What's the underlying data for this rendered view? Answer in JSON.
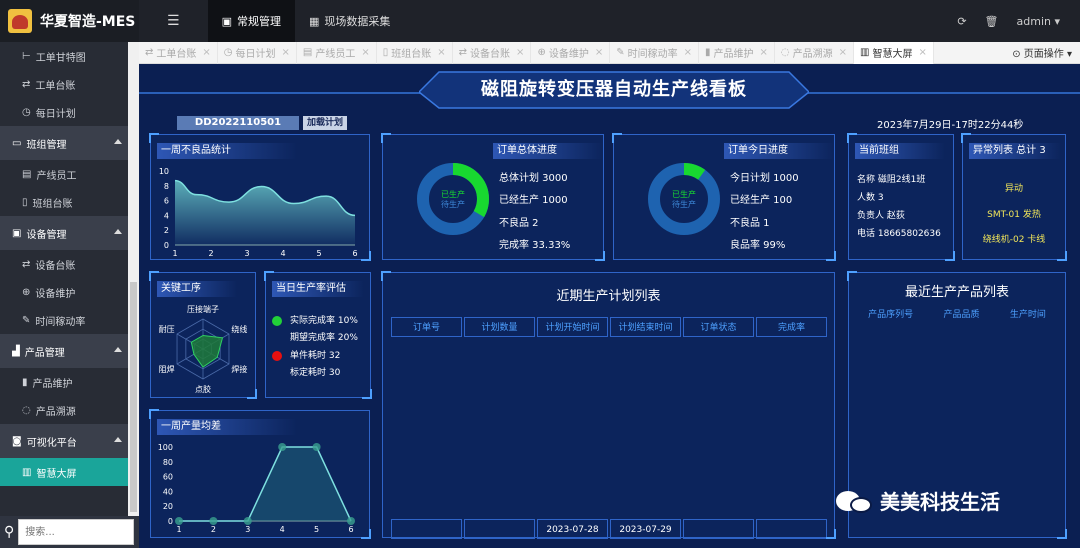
{
  "topbar": {
    "brand": "华夏智造-MES",
    "menu_icon": "menu-icon",
    "tabs": [
      "常规管理",
      "现场数据采集"
    ],
    "user": "admin"
  },
  "sidebar": {
    "items_top": [
      "工单甘特图",
      "工单台账",
      "每日计划"
    ],
    "group1": {
      "label": "班组管理",
      "items": [
        "产线员工",
        "班组台账"
      ]
    },
    "group2": {
      "label": "设备管理",
      "items": [
        "设备台账",
        "设备维护",
        "时间稼动率"
      ]
    },
    "group3": {
      "label": "产品管理",
      "items": [
        "产品维护",
        "产品溯源"
      ]
    },
    "group4": {
      "label": "可视化平台",
      "items": [
        "智慧大屏"
      ]
    },
    "search_placeholder": "搜索..."
  },
  "tabs": [
    {
      "label": "工单台账"
    },
    {
      "label": "每日计划"
    },
    {
      "label": "产线员工"
    },
    {
      "label": "班组台账"
    },
    {
      "label": "设备台账"
    },
    {
      "label": "设备维护"
    },
    {
      "label": "时间稼动率"
    },
    {
      "label": "产品维护"
    },
    {
      "label": "产品溯源"
    },
    {
      "label": "智慧大屏"
    }
  ],
  "tab_ops": "页面操作",
  "dashboard": {
    "title": "磁阻旋转变压器自动生产线看板",
    "order_no": "DD2022110501",
    "load_plan": "加载计划",
    "datetime": "2023年7月29日-17时22分44秒",
    "weekly_defects": {
      "title": "一周不良品统计"
    },
    "total_progress": {
      "title": "订单总体进度",
      "donut_labels": [
        "已生产",
        "待生产"
      ],
      "stats": [
        "总体计划 3000",
        "已经生产 1000",
        "不良品 2",
        "完成率 33.33%"
      ]
    },
    "today_progress": {
      "title": "订单今日进度",
      "donut_labels": [
        "已生产",
        "待生产"
      ],
      "stats": [
        "今日计划 1000",
        "已经生产 100",
        "不良品 1",
        "良品率 99%"
      ]
    },
    "team": {
      "title": "当前班组",
      "stats": [
        "名称 磁阻2线1班",
        "人数 3",
        "负责人 赵荻",
        "电话 18665802636"
      ]
    },
    "abnormal": {
      "title": "异常列表 总计 3",
      "items": [
        "异动",
        "SMT-01 发热",
        "绕线机-02 卡线"
      ]
    },
    "key_process": {
      "title": "关键工序"
    },
    "rate_eval": {
      "title": "当日生产率评估",
      "items": [
        "实际完成率 10%",
        "期望完成率 20%",
        "单件耗时 32",
        "标定耗时 30"
      ],
      "colors": [
        "#22d038",
        "#22d038",
        "#e81010",
        "#e81010"
      ]
    },
    "plan_list": {
      "title": "近期生产计划列表",
      "headers": [
        "订单号",
        "计划数量",
        "计划开始时间",
        "计划结束时间",
        "订单状态",
        "完成率"
      ],
      "row_partial": [
        "",
        "",
        "2023-07-28",
        "2023-07-29",
        "",
        ""
      ]
    },
    "recent_products": {
      "title": "最近生产产品列表",
      "headers": [
        "产品序列号",
        "产品品质",
        "生产时间"
      ]
    },
    "weekly_variance": {
      "title": "一周产量均差"
    },
    "watermark": "美美科技生活"
  },
  "chart_data": [
    {
      "type": "area",
      "title": "一周不良品统计",
      "x": [
        1,
        2,
        3,
        4,
        5,
        6
      ],
      "values": [
        8.7,
        6.8,
        5.8,
        7.9,
        5.6,
        6.6,
        4.0
      ],
      "x_positions": [
        1,
        1.6,
        2.5,
        3.4,
        4.3,
        5.2,
        6
      ],
      "ylim": [
        0,
        10
      ],
      "yticks": [
        0,
        2,
        4,
        6,
        8,
        10
      ],
      "grid": false
    },
    {
      "type": "radar",
      "title": "关键工序",
      "axes": [
        "压接端子",
        "绕线",
        "焊接",
        "点胶",
        "阻焊",
        "耐压"
      ],
      "values": [
        0.45,
        0.75,
        0.55,
        0.6,
        0.35,
        0.45
      ]
    },
    {
      "type": "line",
      "title": "一周产量均差",
      "x": [
        1,
        2,
        3,
        4,
        5,
        6
      ],
      "values": [
        0,
        0,
        0,
        100,
        100,
        0
      ],
      "ylim": [
        0,
        100
      ],
      "yticks": [
        0,
        20,
        40,
        60,
        80,
        100
      ]
    },
    {
      "type": "pie",
      "title": "订单总体进度",
      "values": [
        33.33,
        66.67
      ]
    },
    {
      "type": "pie",
      "title": "订单今日进度",
      "values": [
        10,
        90
      ]
    }
  ]
}
